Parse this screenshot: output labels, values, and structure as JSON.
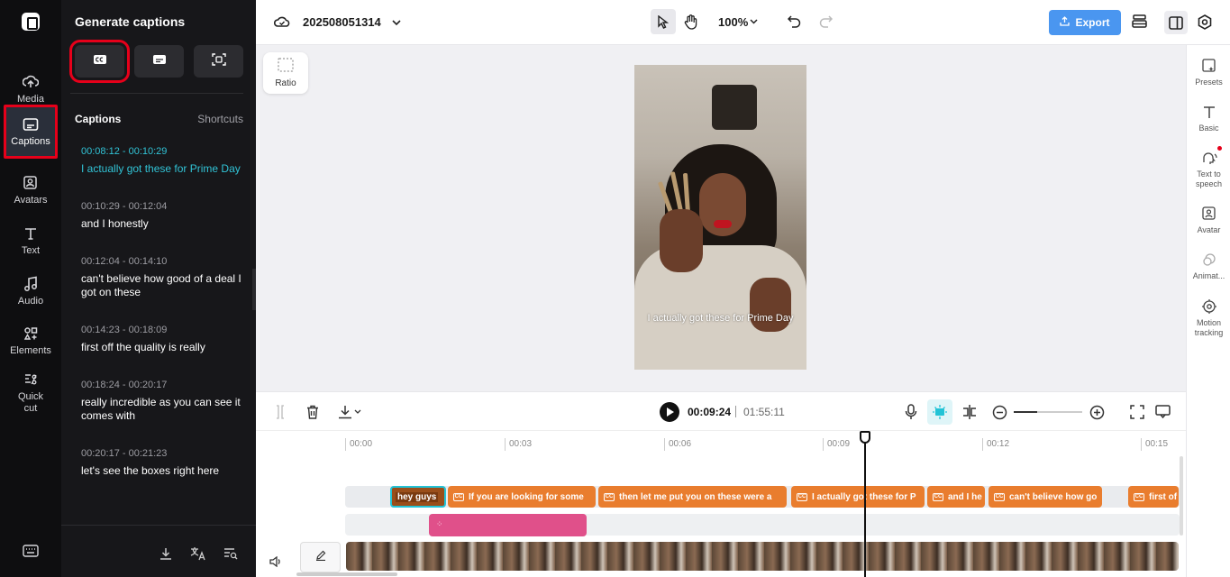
{
  "rail": {
    "items": [
      {
        "label": "Media",
        "icon": "cloud-upload-icon"
      },
      {
        "label": "Captions",
        "icon": "captions-icon"
      },
      {
        "label": "Avatars",
        "icon": "avatar-icon"
      },
      {
        "label": "Text",
        "icon": "text-icon"
      },
      {
        "label": "Audio",
        "icon": "music-note-icon"
      },
      {
        "label": "Elements",
        "icon": "elements-icon"
      },
      {
        "label": "Quick cut",
        "icon": "quick-cut-icon"
      }
    ]
  },
  "panel": {
    "title": "Generate captions",
    "tab_captions": "Captions",
    "tab_shortcuts": "Shortcuts",
    "captions": [
      {
        "time": "00:08:12 - 00:10:29",
        "text": "I actually got these for Prime Day"
      },
      {
        "time": "00:10:29 - 00:12:04",
        "text": "and I honestly"
      },
      {
        "time": "00:12:04 - 00:14:10",
        "text": "can't believe how good of a deal I got on these"
      },
      {
        "time": "00:14:23 - 00:18:09",
        "text": "first off the quality is really"
      },
      {
        "time": "00:18:24 - 00:20:17",
        "text": "really incredible as you can see it comes with"
      },
      {
        "time": "00:20:17 - 00:21:23",
        "text": "let's see the boxes right here"
      }
    ]
  },
  "topbar": {
    "project_name": "202508051314",
    "zoom": "100%",
    "export_label": "Export"
  },
  "canvas": {
    "ratio_label": "Ratio",
    "subtitle": "I actually got these for Prime Day"
  },
  "right_panel": {
    "items": [
      "Presets",
      "Basic",
      "Text to speech",
      "Avatar",
      "Animat...",
      "Motion tracking"
    ]
  },
  "timeline": {
    "current_time": "00:09:24",
    "duration": "01:55:11",
    "ruler": [
      "00:00",
      "00:03",
      "00:06",
      "00:09",
      "00:12",
      "00:15"
    ],
    "clips": [
      {
        "label": "hey guys"
      },
      {
        "label": "If you are looking for some"
      },
      {
        "label": "then let me put you on these were a"
      },
      {
        "label": "I actually got these for P"
      },
      {
        "label": "and I he"
      },
      {
        "label": "can't believe how go"
      },
      {
        "label": "first of"
      }
    ]
  },
  "colors": {
    "accent": "#4a96f0",
    "caption_active": "#31c3d6",
    "clip_orange": "#e97d2e",
    "highlight_red": "#e6001a",
    "pink_track": "#e0508a"
  }
}
